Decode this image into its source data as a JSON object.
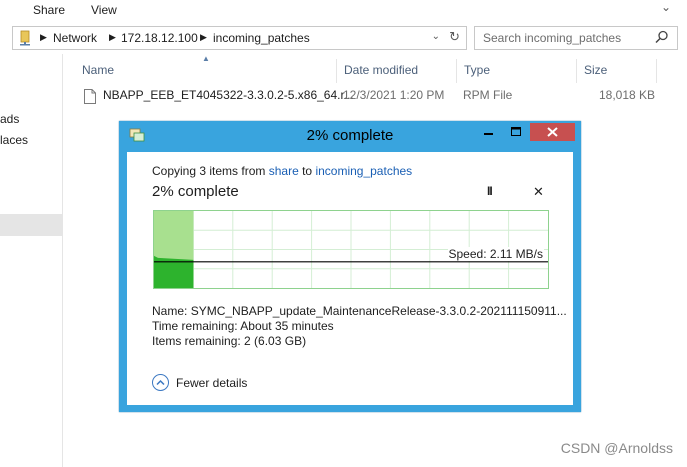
{
  "ribbon": {
    "tabs": [
      "Share",
      "View"
    ],
    "chevron": "⌄"
  },
  "address": {
    "crumbs": [
      "Network",
      "172.18.12.100",
      "incoming_patches"
    ],
    "folder_icon": "network-folder-icon",
    "refresh_glyph": "↻"
  },
  "search": {
    "placeholder": "Search incoming_patches",
    "icon": "magnifier-icon"
  },
  "nav": {
    "items": [
      "ads",
      "laces"
    ]
  },
  "columns": {
    "name": "Name",
    "date": "Date modified",
    "type": "Type",
    "size": "Size"
  },
  "file": {
    "name": "NBAPP_EEB_ET4045322-3.3.0.2-5.x86_64.r...",
    "date": "12/3/2021 1:20 PM",
    "type": "RPM File",
    "size": "18,018 KB"
  },
  "dialog": {
    "title": "2% complete",
    "copy_prefix": "Copying 3 items from ",
    "source": "share",
    "to_word": " to ",
    "dest": "incoming_patches",
    "percent_text": "2% complete",
    "progress_fraction": 0.02,
    "speed": "Speed: 2.11 MB/s",
    "name_label": "Name:",
    "name_value": "SYMC_NBAPP_update_MaintenanceRelease-3.3.0.2-202111150911...",
    "time_label": "Time remaining:",
    "time_value": "About 35 minutes",
    "items_label": "Items remaining:",
    "items_value": "2 (6.03 GB)",
    "fewer_details": "Fewer details",
    "pause_glyph": "II",
    "cancel_glyph": "✕"
  },
  "colors": {
    "dialog_frame": "#39a4de",
    "close_button": "#c75050",
    "progress_fill": "#a8e08f",
    "link": "#1a5fb4"
  },
  "watermark": "CSDN @Arnoldss"
}
